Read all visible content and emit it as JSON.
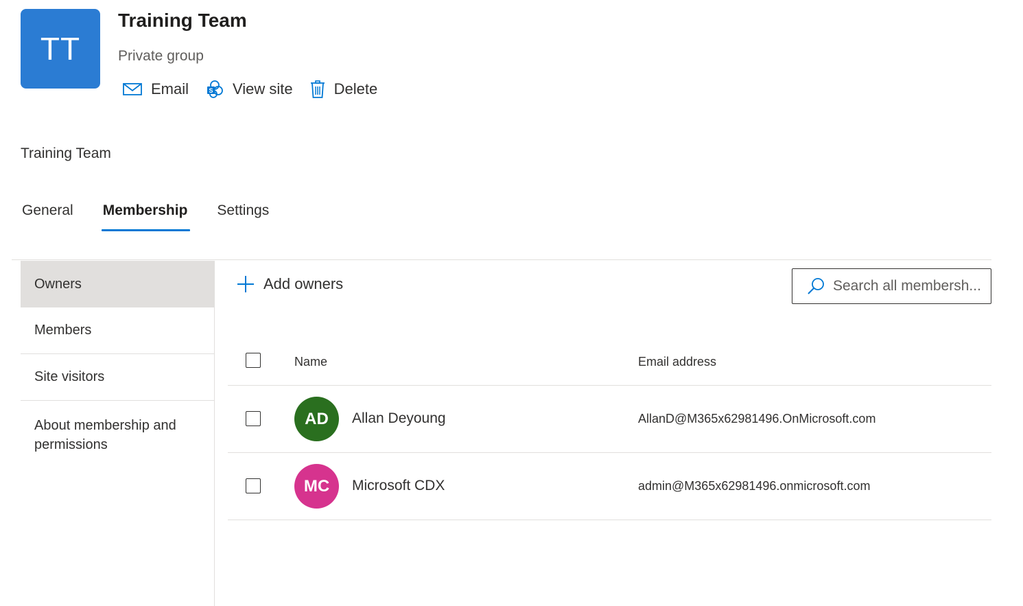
{
  "header": {
    "initials": "TT",
    "title": "Training Team",
    "subtitle": "Private group",
    "tile_color": "#2b7cd3",
    "actions": [
      {
        "label": "Email",
        "icon": "mail-icon"
      },
      {
        "label": "View site",
        "icon": "sharepoint-icon"
      },
      {
        "label": "Delete",
        "icon": "trash-icon"
      }
    ]
  },
  "breadcrumb": "Training Team",
  "tabs": [
    {
      "label": "General",
      "active": false
    },
    {
      "label": "Membership",
      "active": true
    },
    {
      "label": "Settings",
      "active": false
    }
  ],
  "accent_color": "#0078d4",
  "side_nav": [
    {
      "label": "Owners",
      "selected": true
    },
    {
      "label": "Members",
      "selected": false
    },
    {
      "label": "Site visitors",
      "selected": false
    },
    {
      "label": "About membership and permissions",
      "selected": false
    }
  ],
  "toolbar": {
    "add_label": "Add owners",
    "search_placeholder": "Search all membersh..."
  },
  "table": {
    "columns": [
      "Name",
      "Email address"
    ],
    "rows": [
      {
        "initials": "AD",
        "name": "Allan Deyoung",
        "email": "AllanD@M365x62981496.OnMicrosoft.com",
        "avatar_color": "#2a6f1f"
      },
      {
        "initials": "MC",
        "name": "Microsoft CDX",
        "email": "admin@M365x62981496.onmicrosoft.com",
        "avatar_color": "#d6338e"
      }
    ]
  }
}
